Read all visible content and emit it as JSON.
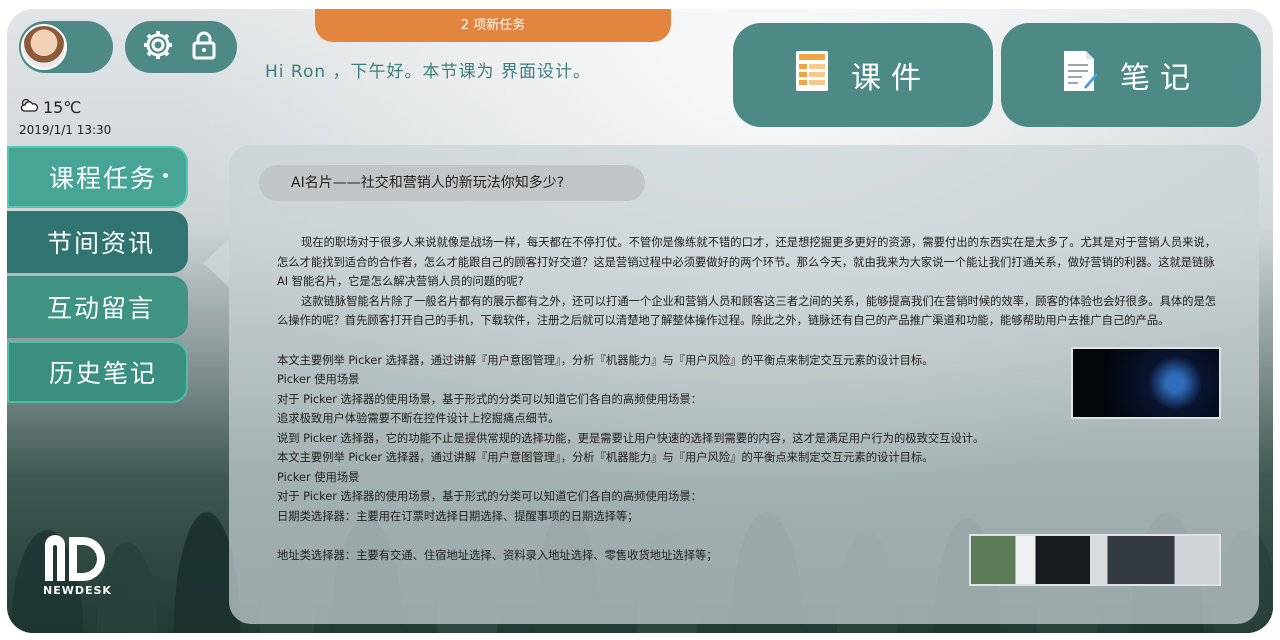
{
  "banner": {
    "new_tasks": "2 项新任务"
  },
  "greeting": "Hi Ron ，下午好。本节课为 界面设计。",
  "weather": {
    "temperature": "15℃",
    "datetime": "2019/1/1 13:30"
  },
  "top_buttons": {
    "courseware": "课件",
    "notes": "笔记"
  },
  "side_menu": [
    "课程任务",
    "节间资讯",
    "互动留言",
    "历史笔记"
  ],
  "article": {
    "title": "AI名片——社交和营销人的新玩法你知多少?",
    "para1": "现在的职场对于很多人来说就像是战场一样，每天都在不停打仗。不管你是像练就不错的口才，还是想挖掘更多更好的资源，需要付出的东西实在是太多了。尤其是对于营销人员来说，怎么才能找到适合的合作者，怎么才能跟自己的顾客打好交道？这是营销过程中必须要做好的两个环节。那么今天，就由我来为大家说一个能让我们打通关系，做好营销的利器。这就是链脉 AI 智能名片，它是怎么解决营销人员的问题的呢?",
    "para2": "这款链脉智能名片除了一般名片都有的展示都有之外，还可以打通一个企业和营销人员和顾客这三者之间的关系，能够提高我们在营销时候的效率，顾客的体验也会好很多。具体的是怎么操作的呢？首先顾客打开自己的手机，下载软件，注册之后就可以清楚地了解整体操作过程。除此之外，链脉还有自己的产品推广渠道和功能，能够帮助用户去推广自己的产品。",
    "lines": [
      "本文主要例举 Picker 选择器，通过讲解『用户意图管理』，分析『机器能力』与『用户风险』的平衡点来制定交互元素的设计目标。",
      "Picker 使用场景",
      "对于 Picker 选择器的使用场景，基于形式的分类可以知道它们各自的高频使用场景：",
      "追求极致用户体验需要不断在控件设计上挖掘痛点细节。",
      "说到 Picker 选择器，它的功能不止是提供常规的选择功能，更是需要让用户快速的选择到需要的内容，这才是满足用户行为的极致交互设计。",
      "本文主要例举 Picker 选择器，通过讲解『用户意图管理』，分析『机器能力』与『用户风险』的平衡点来制定交互元素的设计目标。",
      "Picker 使用场景",
      "对于 Picker 选择器的使用场景，基于形式的分类可以知道它们各自的高频使用场景：",
      "日期类选择器：主要用在订票时选择日期选择、提醒事项的日期选择等；"
    ],
    "last_line": "地址类选择器：主要有交通、住宿地址选择、资料录入地址选择、零售收货地址选择等；"
  },
  "logo": {
    "letters": "ND",
    "wordmark": "NEWDESK"
  },
  "colors": {
    "teal": "#4d8a86",
    "orange": "#e3843f",
    "menu_active": "#47a595"
  }
}
